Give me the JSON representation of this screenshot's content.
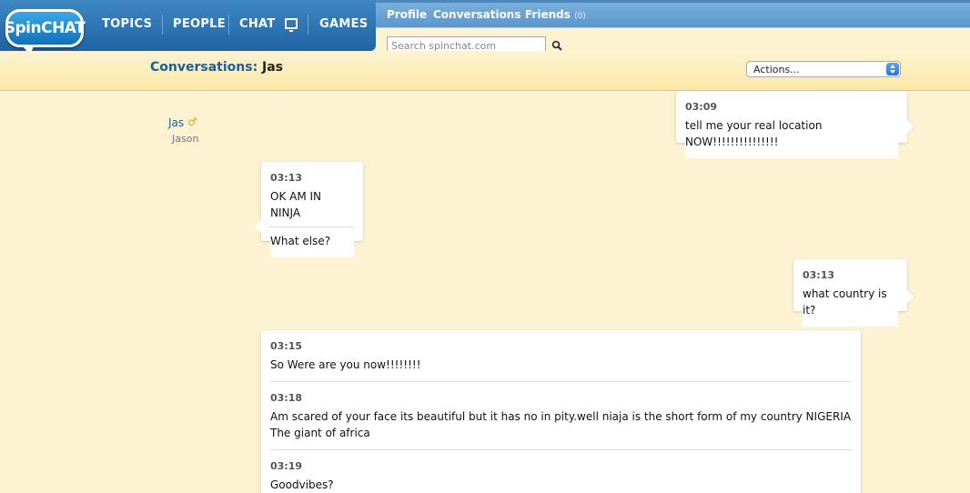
{
  "nav": {
    "logo": "SpinCHAT",
    "topics": "TOPICS",
    "people": "PEOPLE",
    "chat": "CHAT",
    "games": "GAMES"
  },
  "subnav": {
    "profile": "Profile",
    "conversations": "Conversations",
    "friends": "Friends",
    "friends_count": "(0)"
  },
  "search": {
    "placeholder": "Search spinchat.com",
    "icon": "search-icon"
  },
  "header": {
    "label": "Conversations:",
    "name": "Jas",
    "actions": "Actions..."
  },
  "user": {
    "name": "Jas",
    "real_name": "Jason",
    "gender_icon": "male-icon"
  },
  "colors": {
    "nav_blue": "#2b74b5",
    "link_blue": "#1d5f94",
    "background": "#fdf3d3",
    "gender": "#e8a400"
  },
  "messages": [
    {
      "side": "right",
      "items": [
        {
          "time": "03:09",
          "text": "tell me your real location NOW!!!!!!!!!!!!!!!"
        }
      ]
    },
    {
      "side": "left",
      "items": [
        {
          "time": "03:13",
          "text": "OK AM IN NINJA"
        },
        {
          "time": "",
          "text": "What else?"
        }
      ]
    },
    {
      "side": "right",
      "items": [
        {
          "time": "03:13",
          "text": "what country is it?"
        }
      ]
    },
    {
      "side": "left",
      "items": [
        {
          "time": "03:15",
          "text": "So Were are you now!!!!!!!!"
        },
        {
          "time": "03:18",
          "text": "Am scared of your face its beautiful but it has no in pity.well niaja is the short form of my country NIGERIA The giant of africa"
        },
        {
          "time": "03:19",
          "text": "Goodvibes?"
        }
      ]
    }
  ]
}
